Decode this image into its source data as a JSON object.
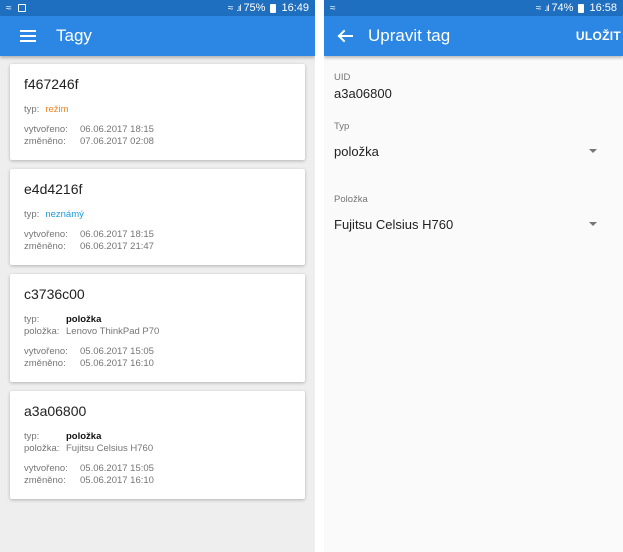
{
  "left": {
    "statusbar": {
      "battery": "75%",
      "time": "16:49"
    },
    "appbar": {
      "title": "Tagy",
      "nav_icon": "hamburger-menu-icon"
    },
    "cards": [
      {
        "uid": "f467246f",
        "type_label": "typ:",
        "type": "režim",
        "type_color": "#f5821f",
        "item_label": "",
        "item": "",
        "created_label": "vytvořeno:",
        "created": "06.06.2017 18:15",
        "modified_label": "změněno:",
        "modified": "07.06.2017 02:08"
      },
      {
        "uid": "e4d4216f",
        "type_label": "typ:",
        "type": "neznámý",
        "type_color": "#1e9ad6",
        "item_label": "",
        "item": "",
        "created_label": "vytvořeno:",
        "created": "06.06.2017 18:15",
        "modified_label": "změněno:",
        "modified": "06.06.2017 21:47"
      },
      {
        "uid": "c3736c00",
        "type_label": "typ:",
        "type": "položka",
        "type_color": "#111111",
        "item_label": "položka:",
        "item": "Lenovo ThinkPad P70",
        "created_label": "vytvořeno:",
        "created": "05.06.2017 15:05",
        "modified_label": "změněno:",
        "modified": "05.06.2017 16:10"
      },
      {
        "uid": "a3a06800",
        "type_label": "typ:",
        "type": "položka",
        "type_color": "#111111",
        "item_label": "položka:",
        "item": "Fujitsu Celsius H760",
        "created_label": "vytvořeno:",
        "created": "05.06.2017 15:05",
        "modified_label": "změněno:",
        "modified": "05.06.2017 16:10"
      }
    ]
  },
  "right": {
    "statusbar": {
      "battery": "74%",
      "time": "16:58"
    },
    "appbar": {
      "title": "Upravit tag",
      "action": "ULOŽIT",
      "nav_icon": "back-arrow-icon"
    },
    "form": {
      "uid_label": "UID",
      "uid_value": "a3a06800",
      "type_label": "Typ",
      "type_value": "položka",
      "item_label": "Položka",
      "item_value": "Fujitsu Celsius H760"
    }
  },
  "colors": {
    "statusbar": "#1f6fc0",
    "appbar": "#2b87e3"
  }
}
